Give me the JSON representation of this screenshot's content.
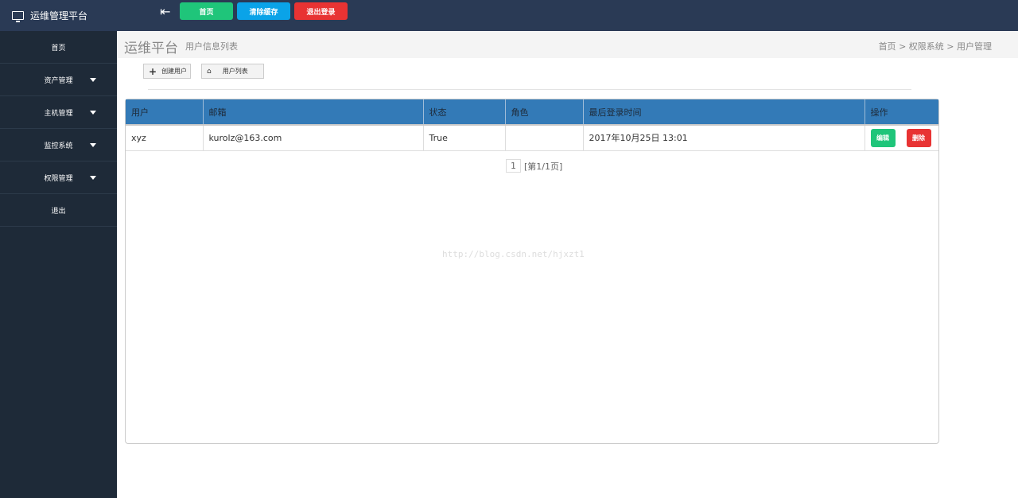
{
  "app": {
    "title": "运维管理平台",
    "icon": "monitor-icon"
  },
  "topbar": {
    "home": "首页",
    "clear_cache": "清除缓存",
    "logout": "退出登录",
    "colors": {
      "home": "#1fc57a",
      "clear": "#0aa3e8",
      "logout": "#e83333"
    }
  },
  "sidebar": {
    "items": [
      {
        "label": "首页"
      },
      {
        "label": "资产管理"
      },
      {
        "label": "主机管理"
      },
      {
        "label": "监控系统"
      },
      {
        "label": "权限管理"
      },
      {
        "label": "退出"
      }
    ]
  },
  "page": {
    "title": "运维平台",
    "subtitle": "用户信息列表",
    "breadcrumb": [
      "首页",
      "权限系统",
      "用户管理"
    ],
    "sep": ">"
  },
  "actions": {
    "create": "创建用户",
    "list": "用户列表"
  },
  "table": {
    "headers": [
      "用户",
      "邮箱",
      "状态",
      "角色",
      "最后登录时间",
      "操作"
    ],
    "rows": [
      {
        "user": "xyz",
        "email": "kurolz@163.com",
        "status": "True",
        "role": "",
        "last_login": "2017年10月25日 13:01",
        "edit": "编辑",
        "delete": "删除"
      }
    ]
  },
  "pager": {
    "page": "1",
    "info": "[第1/1页]"
  },
  "watermark": "http://blog.csdn.net/hjxzt1"
}
